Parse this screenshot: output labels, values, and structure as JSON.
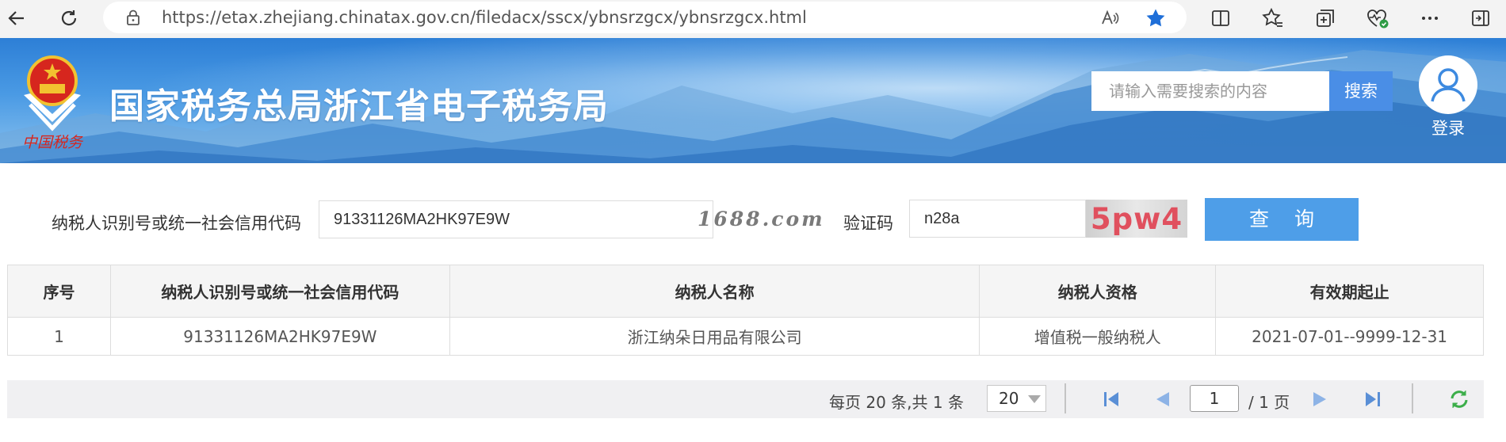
{
  "browser": {
    "url": "https://etax.zhejiang.chinatax.gov.cn/filedacx/sscx/ybnsrzgcx/ybnsrzgcx.html"
  },
  "header": {
    "emblem_text": "中国税务",
    "title": "国家税务总局浙江省电子税务局",
    "search_placeholder": "请输入需要搜索的内容",
    "search_button": "搜索",
    "login_label": "登录"
  },
  "form": {
    "taxpayer_id_label": "纳税人识别号或统一社会信用代码",
    "taxpayer_id_value": "91331126MA2HK97E9W",
    "watermark": "1688.com",
    "captcha_label": "验证码",
    "captcha_value": "n28a",
    "captcha_image_text": "5pw4",
    "query_button": "查 询"
  },
  "table": {
    "headers": [
      "序号",
      "纳税人识别号或统一社会信用代码",
      "纳税人名称",
      "纳税人资格",
      "有效期起止"
    ],
    "rows": [
      [
        "1",
        "91331126MA2HK97E9W",
        "浙江纳朵日用品有限公司",
        "增值税一般纳税人",
        "2021-07-01--9999-12-31"
      ]
    ]
  },
  "pager": {
    "summary": "每页 20 条,共 1 条",
    "page_size": "20",
    "current_page": "1",
    "total_pages": "/ 1 页"
  },
  "colors": {
    "accent": "#4e9ee8",
    "search_button": "#4a8ee6",
    "captcha_text": "#e0505e",
    "pager_icon": "#5a8fd6",
    "refresh_icon": "#3cae4a"
  }
}
